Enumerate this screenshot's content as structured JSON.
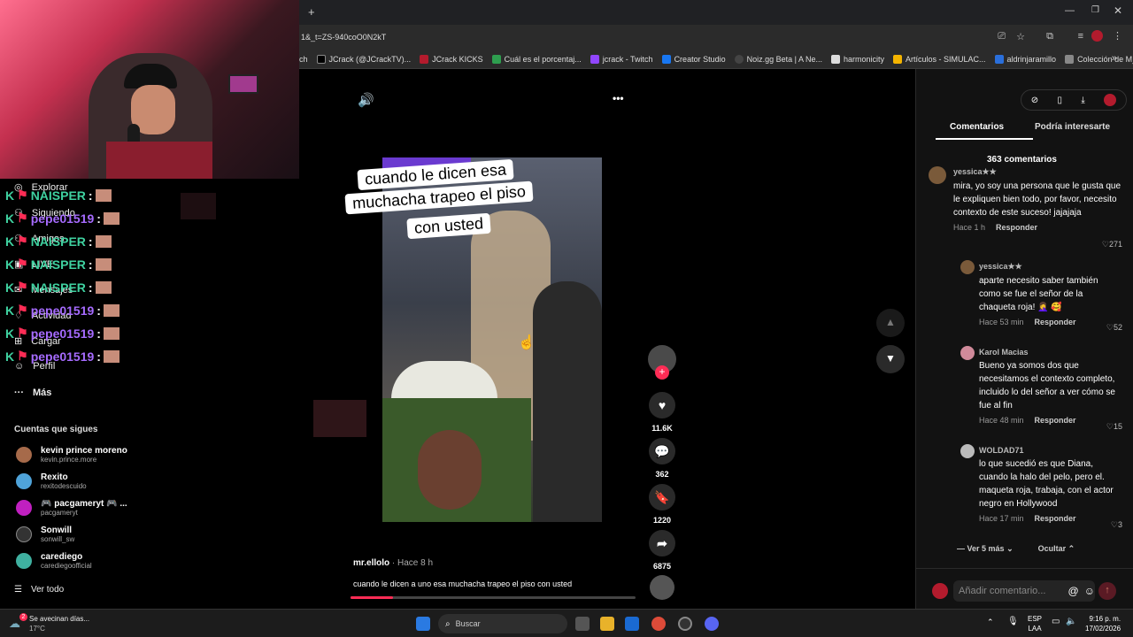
{
  "browser": {
    "url": "1&_t=ZS-940coO0N2kT",
    "new_tab": "+",
    "bookmarks": [
      "ch",
      "JCrack (@JCrackTV)...",
      "JCrack KICKS",
      "Cuál es el porcentaj...",
      "jcrack - Twitch",
      "Creator Studio",
      "Noiz.gg Beta | A Ne...",
      "harmonicity",
      "Artículos - SIMULAC...",
      "aldrinjaramillo",
      "Colección de M_blei..."
    ],
    "bookmarks_more": "»"
  },
  "sidebar": {
    "nav": [
      {
        "label": "Explorar"
      },
      {
        "label": "Siguiendo"
      },
      {
        "label": "Amigos"
      },
      {
        "label": "LIVE"
      },
      {
        "label": "Mensajes"
      },
      {
        "label": "Actividad"
      },
      {
        "label": "Cargar"
      },
      {
        "label": "Perfil"
      }
    ],
    "more": "Más",
    "following_title": "Cuentas que sigues",
    "following": [
      {
        "name": "kevin prince moreno",
        "handle": "kevin.prince.more"
      },
      {
        "name": "Rexito",
        "handle": "rexitodescuido"
      },
      {
        "name": "🎮 pacgameryt 🎮 ...",
        "handle": "pacgameryt"
      },
      {
        "name": "Sonwill",
        "handle": "sonwill_sw"
      },
      {
        "name": "carediego",
        "handle": "carediegoofficial"
      }
    ],
    "see_all": "Ver todo"
  },
  "chat": [
    {
      "user": "NAISPER",
      "sep": ":",
      "color": "#3fd1a0"
    },
    {
      "user": "pepe01519",
      "sep": ":",
      "color": "#a66bff"
    },
    {
      "user": "NAISPER",
      "sep": ":",
      "color": "#3fd1a0"
    },
    {
      "user": "NAISPER",
      "sep": ":",
      "color": "#3fd1a0"
    },
    {
      "user": "NAISPER",
      "sep": ":",
      "color": "#3fd1a0"
    },
    {
      "user": "pepe01519",
      "sep": ":",
      "color": "#a66bff"
    },
    {
      "user": "pepe01519",
      "sep": ":",
      "color": "#a66bff"
    },
    {
      "user": "pepe01519",
      "sep": ":",
      "color": "#a66bff"
    }
  ],
  "video": {
    "caption_lines": [
      "cuando le  dicen  esa",
      "muchacha  trapeo el piso",
      "con usted"
    ],
    "author": "mr.ellolo",
    "time": "· Hace 8 h",
    "description": "cuando le dicen a uno  esa muchacha trapeo el piso con usted",
    "progress": 0.15,
    "more_icon": "•••"
  },
  "actions": {
    "likes": "11.6K",
    "comments": "362",
    "saves": "1220",
    "shares": "6875"
  },
  "comments_panel": {
    "tab_comments": "Comentarios",
    "tab_interesting": "Podría interesarte",
    "count": "363 comentarios",
    "items": [
      {
        "user": "yessica★★",
        "text": "mira, yo soy una persona que le gusta que le expliquen bien todo, por favor, necesito contexto de este suceso! jajajaja",
        "time": "Hace 1 h",
        "reply": "Responder",
        "likes": "271"
      },
      {
        "user": "yessica★★",
        "text": "aparte necesito saber también como se fue el señor de la chaqueta roja! 🤦‍♀️ 🥰",
        "time": "Hace 53 min",
        "reply": "Responder",
        "likes": "52"
      },
      {
        "user": "Karol Macias",
        "text": "Bueno ya somos dos que necesitamos el contexto completo, incluido lo del señor a ver cómo se fue al fin",
        "time": "Hace 48 min",
        "reply": "Responder",
        "likes": "15"
      },
      {
        "user": "WOLDAD71",
        "text": "lo que sucedió es que Diana, cuando la halo del pelo, pero el. maqueta roja, trabaja, con el actor negro en Hollywood",
        "time": "Hace 17 min",
        "reply": "Responder",
        "likes": "3"
      }
    ],
    "see_more": "Ver 5 más",
    "hide": "Ocultar",
    "add_placeholder": "Añadir comentario...",
    "at": "@"
  },
  "taskbar": {
    "weather_title": "Se avecinan días...",
    "weather_temp": "17°C",
    "weather_badge": "2",
    "search_placeholder": "Buscar",
    "lang": "ESP",
    "lang2": "LAA",
    "time": "9:16 p. m.",
    "date": "17/02/2026"
  },
  "colors": {
    "accent": "#fe2c55"
  }
}
